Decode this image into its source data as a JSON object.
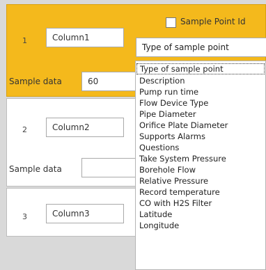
{
  "rows": [
    {
      "number": "1",
      "column_value": "Column1",
      "sample_label": "Sample data",
      "sample_value": "60",
      "sample_point_id_label": "Sample Point Id",
      "select_value": "Type of sample point"
    },
    {
      "number": "2",
      "column_value": "Column2",
      "sample_label": "Sample data",
      "sample_value": ""
    },
    {
      "number": "3",
      "column_value": "Column3"
    }
  ],
  "dropdown": {
    "options": [
      "Type of sample point",
      "Description",
      "Pump run time",
      "Flow Device Type",
      "Pipe Diameter",
      "Orifice Plate Diameter",
      "Supports Alarms",
      "Questions",
      "Take System Pressure",
      "Borehole Flow",
      "Relative Pressure",
      "Record temperature",
      "CO with H2S Filter",
      "Latitude",
      "Longitude"
    ]
  },
  "colors": {
    "selected_row_bg": "#f4b91c",
    "page_bg": "#d9d9d9"
  }
}
